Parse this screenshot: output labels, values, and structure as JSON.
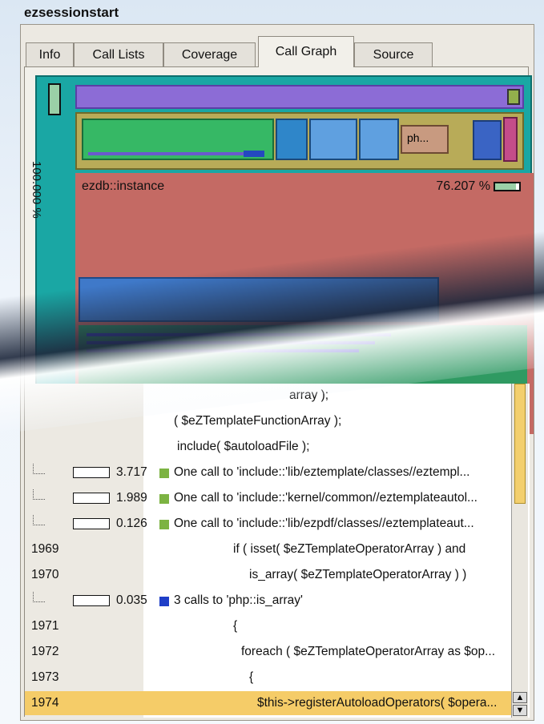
{
  "app": {
    "title": "ezsessionstart"
  },
  "tabs": [
    {
      "label": "Info",
      "active": false
    },
    {
      "label": "Call Lists",
      "active": false
    },
    {
      "label": "Coverage",
      "active": false
    },
    {
      "label": "Call Graph",
      "active": true
    },
    {
      "label": "Source",
      "active": false
    }
  ],
  "call_graph": {
    "root_fraction": "100.000 %",
    "small_node_label": "ph...",
    "main_node_label": "ezdb::instance",
    "main_node_percent": "76.207 %"
  },
  "source": {
    "rows": [
      {
        "kind": "code",
        "line": "",
        "text": "array );"
      },
      {
        "kind": "code",
        "line": "",
        "text": "( $eZTemplateFunctionArray );"
      },
      {
        "kind": "code",
        "line": "",
        "text": "include( $autoloadFile );"
      },
      {
        "kind": "call",
        "cost": "3.717",
        "color": "#7cb342",
        "text": "One call to 'include::'lib/eztemplate/classes//eztempl..."
      },
      {
        "kind": "call",
        "cost": "1.989",
        "color": "#7cb342",
        "text": "One call to 'include::'kernel/common//eztemplateautol..."
      },
      {
        "kind": "call",
        "cost": "0.126",
        "color": "#7cb342",
        "text": "One call to 'include::'lib/ezpdf/classes//eztemplateaut..."
      },
      {
        "kind": "code",
        "line": "1969",
        "text": "if ( isset( $eZTemplateOperatorArray ) and"
      },
      {
        "kind": "code",
        "line": "1970",
        "text": "is_array( $eZTemplateOperatorArray ) )"
      },
      {
        "kind": "call",
        "cost": "0.035",
        "color": "#1f3fc8",
        "text": "3 calls to 'php::is_array'"
      },
      {
        "kind": "code",
        "line": "1971",
        "text": "{"
      },
      {
        "kind": "code",
        "line": "1972",
        "text": "foreach ( $eZTemplateOperatorArray as $op..."
      },
      {
        "kind": "code",
        "line": "1973",
        "text": "{"
      },
      {
        "kind": "code",
        "line": "1974",
        "text": "$this->registerAutoloadOperators( $opera...",
        "highlight": true
      }
    ]
  },
  "colors": {
    "treemap_teal": "#1aa7a4",
    "treemap_red": "#c46a64",
    "treemap_purple": "#8c6cd6",
    "highlight": "#f5cc68"
  }
}
